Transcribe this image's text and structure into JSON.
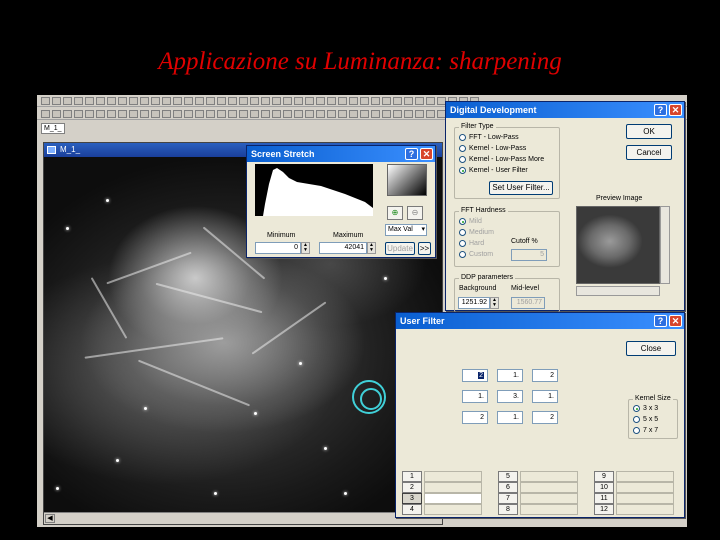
{
  "slide": {
    "title": "Applicazione  su Luminanza: sharpening"
  },
  "app": {
    "document_tab": "M_1_",
    "image_window": {
      "title": "M_1_"
    }
  },
  "screen_stretch": {
    "title": "Screen Stretch",
    "minimum_label": "Minimum",
    "maximum_label": "Maximum",
    "minimum_value": "0",
    "maximum_value": "42041",
    "mode_select": "Max Val",
    "update_button": "Update",
    "more_button": ">>"
  },
  "digital_development": {
    "title": "Digital Development",
    "ok_button": "OK",
    "cancel_button": "Cancel",
    "filter_type": {
      "label": "Filter Type",
      "options": [
        "FFT - Low-Pass",
        "Kernel - Low-Pass",
        "Kernel - Low-Pass More",
        "Kernel - User Filter"
      ],
      "selected_index": 3
    },
    "set_user_filter_button": "Set User Filter...",
    "fft_hardness": {
      "label": "FFT Hardness",
      "options": [
        "Mild",
        "Medium",
        "Hard",
        "Custom"
      ],
      "cutoff_label": "Cutoff %",
      "cutoff_value": "5"
    },
    "ddp_parameters": {
      "label": "DDP parameters",
      "background_label": "Background",
      "midlevel_label": "Mid-level",
      "background_value": "1251.92",
      "midlevel_value": "1560.77"
    },
    "preview_label": "Preview Image"
  },
  "user_filter": {
    "title": "User Filter",
    "close_button": "Close",
    "kernel": [
      [
        "2",
        "1.",
        "2"
      ],
      [
        "1.",
        "3.",
        "1."
      ],
      [
        "2",
        "1.",
        "2"
      ]
    ],
    "kernel_size": {
      "label": "Kernel Size",
      "options": [
        "3 x 3",
        "5 x 5",
        "7 x 7"
      ],
      "selected_index": 0
    },
    "channels": [
      "1",
      "2",
      "3",
      "4",
      "5",
      "6",
      "7",
      "8",
      "9",
      "10",
      "11",
      "12"
    ],
    "active_channel": "3"
  }
}
